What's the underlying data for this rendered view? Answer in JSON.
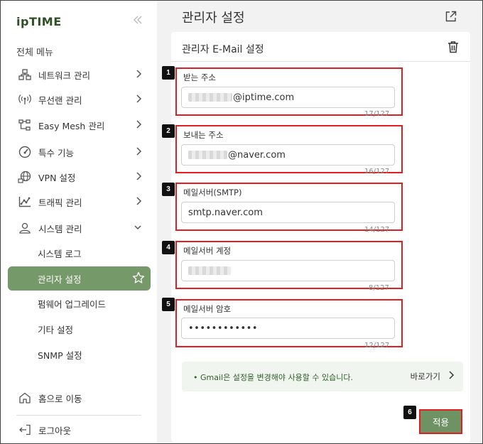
{
  "sidebar": {
    "logo": "ipTIME",
    "collapse_icon": "double-chevron-left-icon",
    "menu_title": "전체 메뉴",
    "items": [
      {
        "label": "네트워크 관리",
        "icon": "network-icon"
      },
      {
        "label": "무선랜 관리",
        "icon": "wifi-icon"
      },
      {
        "label": "Easy Mesh 관리",
        "icon": "mesh-icon"
      },
      {
        "label": "특수 기능",
        "icon": "gauge-icon"
      },
      {
        "label": "VPN 설정",
        "icon": "globe-icon"
      },
      {
        "label": "트래픽 관리",
        "icon": "traffic-chart-icon"
      },
      {
        "label": "시스템 관리",
        "icon": "user-icon"
      }
    ],
    "sub_items": [
      {
        "label": "시스템 로그"
      },
      {
        "label": "관리자 설정"
      },
      {
        "label": "펌웨어 업그레이드"
      },
      {
        "label": "기타 설정"
      },
      {
        "label": "SNMP 설정"
      }
    ],
    "home_label": "홈으로 이동",
    "logout_label": "로그아웃"
  },
  "main": {
    "page_title": "관리자 설정",
    "card_title": "관리자 E-Mail 설정",
    "fields": [
      {
        "number": "1",
        "label": "받는 주소",
        "value": "@iptime.com",
        "counter": "17/127"
      },
      {
        "number": "2",
        "label": "보내는 주소",
        "value": "@naver.com",
        "counter": "16/127"
      },
      {
        "number": "3",
        "label": "메일서버(SMTP)",
        "value": "smtp.naver.com",
        "counter": "14/127"
      },
      {
        "number": "4",
        "label": "메일서버 계정",
        "value": "",
        "counter": "8/127"
      },
      {
        "number": "5",
        "label": "메일서버 암호",
        "value": "••••••••••••",
        "counter": "12/127"
      }
    ],
    "info_text": "• Gmail은 설정을 변경해야 사용할 수 있습니다.",
    "info_link": "바로가기",
    "apply_number": "6",
    "apply_label": "적용"
  },
  "colors": {
    "accent": "#76996a",
    "highlight": "#e02020"
  }
}
